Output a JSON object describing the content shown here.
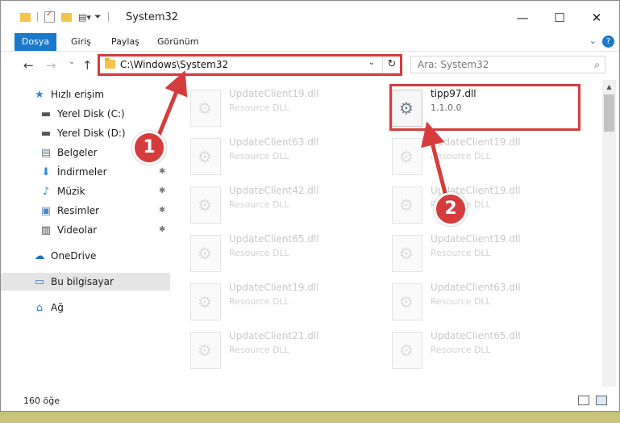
{
  "window": {
    "title": "System32",
    "controls": {
      "minimize": "—",
      "maximize": "☐",
      "close": "✕"
    }
  },
  "ribbon": {
    "tabs": [
      "Dosya",
      "Giriş",
      "Paylaş",
      "Görünüm"
    ],
    "expand_icon": "⌄",
    "help_icon": "?"
  },
  "nav": {
    "back": "←",
    "forward": "→",
    "recent": "⌄",
    "up": "↑",
    "address_path": "C:\\Windows\\System32",
    "address_dropdown": "⌄",
    "refresh": "↻",
    "search_placeholder": "Ara: System32",
    "search_icon": "⌕"
  },
  "sidebar": {
    "items": [
      {
        "label": "Hızlı erişim",
        "icon": "★",
        "icon_color": "#2b88d8"
      },
      {
        "label": "Yerel Disk (C:)",
        "icon": "▬",
        "icon_color": "#555555"
      },
      {
        "label": "Yerel Disk (D:)",
        "icon": "▬",
        "icon_color": "#555555"
      },
      {
        "label": "Belgeler",
        "icon": "▤",
        "icon_color": "#6a7a8a"
      },
      {
        "label": "İndirmeler",
        "icon": "⬇",
        "icon_color": "#2b88d8"
      },
      {
        "label": "Müzik",
        "icon": "♪",
        "icon_color": "#2b88d8"
      },
      {
        "label": "Resimler",
        "icon": "▣",
        "icon_color": "#4a8ac8"
      },
      {
        "label": "Videolar",
        "icon": "▥",
        "icon_color": "#444444"
      },
      {
        "label": "OneDrive",
        "icon": "☁",
        "icon_color": "#1e6fc9"
      },
      {
        "label": "Bu bilgisayar",
        "icon": "▭",
        "icon_color": "#2f7fd0"
      },
      {
        "label": "Ağ",
        "icon": "⌂",
        "icon_color": "#2f7fd0"
      }
    ],
    "pin_icon": "📌"
  },
  "files": [
    {
      "name": "UpdateClient19.dll",
      "desc": "Resource DLL"
    },
    {
      "name": "tipp97.dll",
      "desc": "1.1.0.0",
      "active": true
    },
    {
      "name": "UpdateClient63.dll",
      "desc": "Resource DLL"
    },
    {
      "name": "UpdateClient19.dll",
      "desc": "Resource DLL"
    },
    {
      "name": "UpdateClient42.dll",
      "desc": "Resource DLL"
    },
    {
      "name": "UpdateClient19.dll",
      "desc": "Resource DLL"
    },
    {
      "name": "UpdateClient65.dll",
      "desc": "Resource DLL"
    },
    {
      "name": "UpdateClient19.dll",
      "desc": "Resource DLL"
    },
    {
      "name": "UpdateClient19.dll",
      "desc": "Resource DLL"
    },
    {
      "name": "UpdateClient63.dll",
      "desc": "Resource DLL"
    },
    {
      "name": "UpdateClient21.dll",
      "desc": "Resource DLL"
    },
    {
      "name": "UpdateClient65.dll",
      "desc": "Resource DLL"
    }
  ],
  "status": {
    "count": "160 öğe"
  },
  "callouts": [
    "1",
    "2"
  ],
  "colors": {
    "accent": "#1979ca",
    "annotation": "#d63c3c"
  }
}
